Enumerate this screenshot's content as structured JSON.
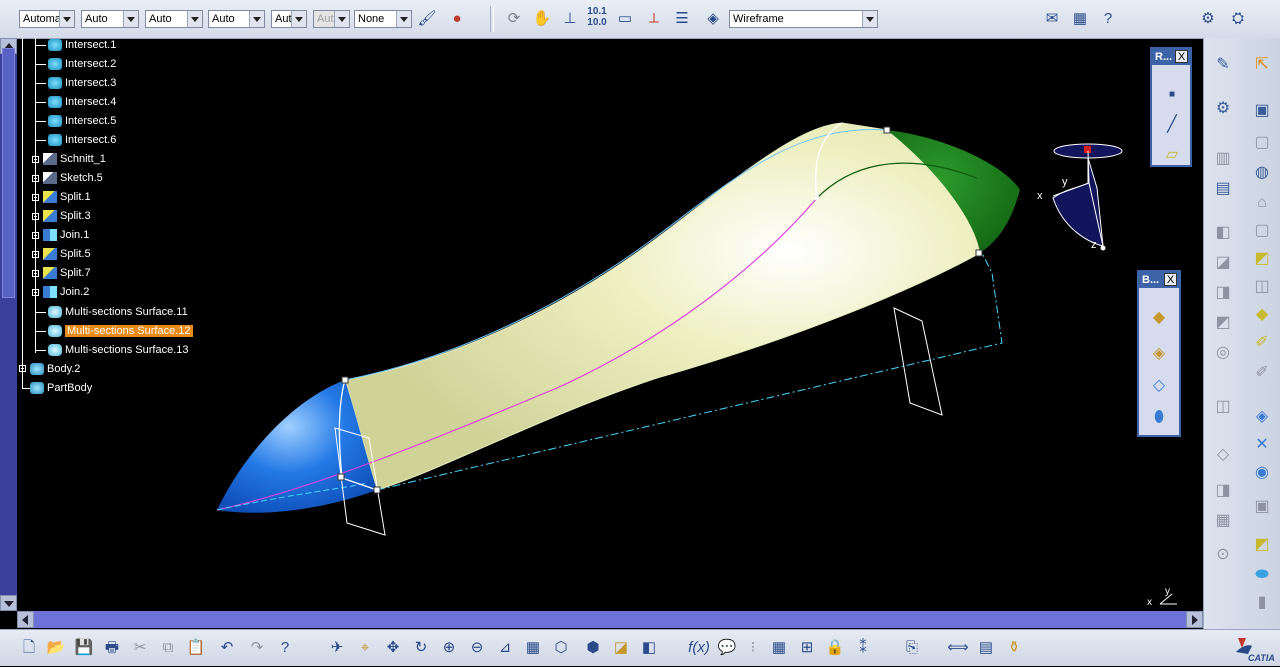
{
  "toolbar": {
    "combos": [
      {
        "value": "Automa",
        "enabled": true
      },
      {
        "value": "Auto",
        "enabled": true
      },
      {
        "value": "Auto",
        "enabled": true
      },
      {
        "value": "Auto",
        "enabled": true
      },
      {
        "value": "Aut",
        "enabled": true
      },
      {
        "value": "Aut",
        "enabled": false
      },
      {
        "value": "None",
        "enabled": true
      }
    ],
    "render_style": "Wireframe"
  },
  "tree": {
    "items": [
      {
        "label": "Intersect.1",
        "icon": "intersect-icon"
      },
      {
        "label": "Intersect.2",
        "icon": "intersect-icon"
      },
      {
        "label": "Intersect.3",
        "icon": "intersect-icon"
      },
      {
        "label": "Intersect.4",
        "icon": "intersect-icon"
      },
      {
        "label": "Intersect.5",
        "icon": "intersect-icon"
      },
      {
        "label": "Intersect.6",
        "icon": "intersect-icon"
      },
      {
        "label": "Schnitt_1",
        "icon": "sketch-icon"
      },
      {
        "label": "Sketch.5",
        "icon": "sketch-icon"
      },
      {
        "label": "Split.1",
        "icon": "split-icon"
      },
      {
        "label": "Split.3",
        "icon": "split-icon"
      },
      {
        "label": "Join.1",
        "icon": "join-icon"
      },
      {
        "label": "Split.5",
        "icon": "split-icon"
      },
      {
        "label": "Split.7",
        "icon": "split-icon"
      },
      {
        "label": "Join.2",
        "icon": "join-icon"
      },
      {
        "label": "Multi-sections Surface.11",
        "icon": "multisection-surface-icon"
      },
      {
        "label": "Multi-sections Surface.12",
        "icon": "multisection-surface-icon",
        "selected": true
      },
      {
        "label": "Multi-sections Surface.13",
        "icon": "multisection-surface-icon"
      },
      {
        "label": "Body.2",
        "icon": "body-icon"
      },
      {
        "label": "PartBody",
        "icon": "partbody-icon"
      }
    ]
  },
  "panels": {
    "reference": {
      "title": "R...",
      "close": "X"
    },
    "boolean": {
      "title": "B...",
      "close": "X"
    }
  },
  "compass": {
    "x": "x",
    "y": "y",
    "z": "z"
  },
  "axis_small": {
    "x": "x",
    "y": "y"
  },
  "colors": {
    "background": "#000000",
    "surface_main": "#eceeb8",
    "surface_tip": "#1f6fe0",
    "surface_end": "#1b7a1b",
    "selection": "#e88a17",
    "scroll": "#3b3f9d"
  },
  "brand": "CATIA"
}
